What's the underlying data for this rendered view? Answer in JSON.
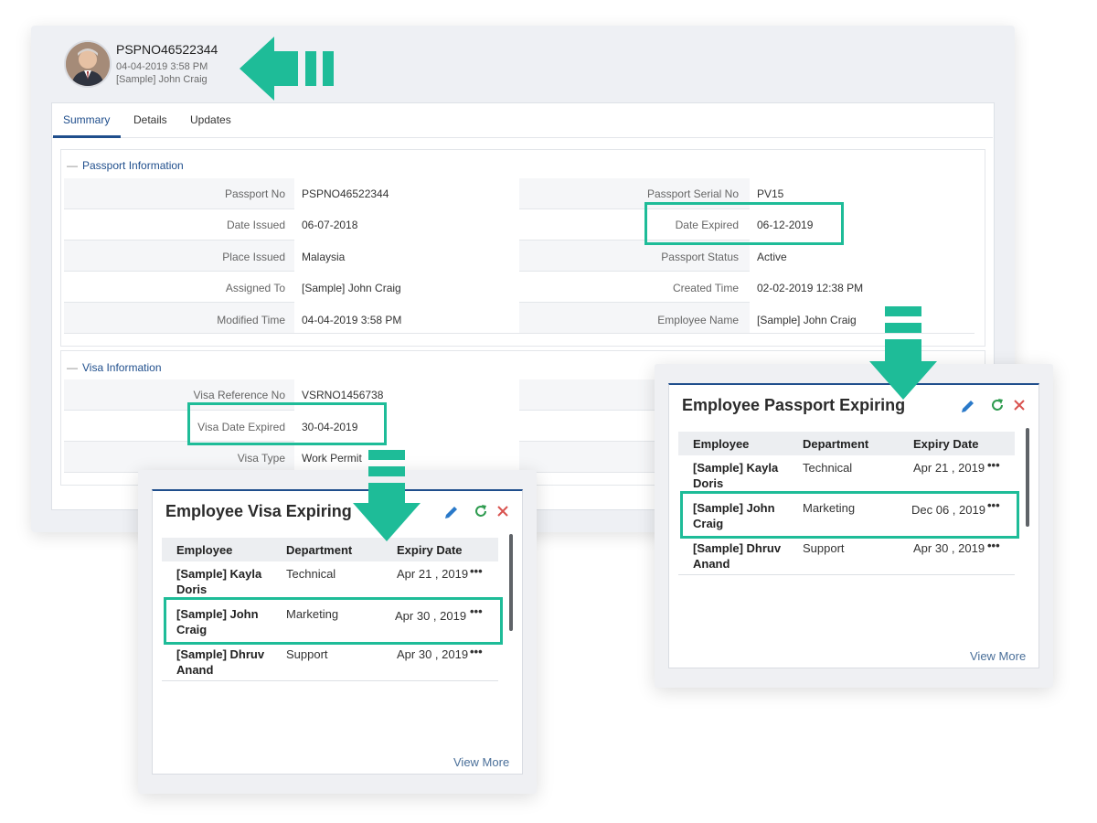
{
  "record": {
    "title": "PSPNO46522344",
    "timestamp": "04-04-2019 3:58 PM",
    "owner": "[Sample] John Craig",
    "tabs": [
      "Summary",
      "Details",
      "Updates"
    ]
  },
  "passport_section": {
    "heading": "Passport Information",
    "collapse_icon": "minus-icon",
    "left": [
      {
        "label": "Passport No",
        "value": "PSPNO46522344"
      },
      {
        "label": "Date Issued",
        "value": "06-07-2018"
      },
      {
        "label": "Place Issued",
        "value": "Malaysia"
      },
      {
        "label": "Assigned To",
        "value": "[Sample] John Craig"
      },
      {
        "label": "Modified Time",
        "value": "04-04-2019 3:58 PM"
      }
    ],
    "right": [
      {
        "label": "Passport Serial No",
        "value": "PV15"
      },
      {
        "label": "Date Expired",
        "value": "06-12-2019"
      },
      {
        "label": "Passport Status",
        "value": "Active"
      },
      {
        "label": "Created Time",
        "value": "02-02-2019 12:38 PM"
      },
      {
        "label": "Employee Name",
        "value": "[Sample] John Craig"
      }
    ]
  },
  "visa_section": {
    "heading": "Visa Information",
    "collapse_icon": "minus-icon",
    "left": [
      {
        "label": "Visa Reference No",
        "value": "VSRNO1456738"
      },
      {
        "label": "Visa Date Expired",
        "value": "30-04-2019"
      },
      {
        "label": "Visa Type",
        "value": "Work Permit"
      }
    ]
  },
  "visa_widget": {
    "title": "Employee Visa Expiring",
    "columns": [
      "Employee",
      "Department",
      "Expiry Date"
    ],
    "rows": [
      {
        "name1": "[Sample] Kayla",
        "name2": "Doris",
        "department": "Technical",
        "expiry": "Apr 21 , 2019"
      },
      {
        "name1": "[Sample] John",
        "name2": "Craig",
        "department": "Marketing",
        "expiry": "Apr 30  , 2019"
      },
      {
        "name1": "[Sample] Dhruv",
        "name2": "Anand",
        "department": "Support",
        "expiry": "Apr 30 , 2019"
      }
    ],
    "more_icon": "•••",
    "view_more": "View More",
    "icons": [
      "edit-icon",
      "refresh-icon",
      "close-icon"
    ]
  },
  "passport_widget": {
    "title": "Employee Passport Expiring",
    "columns": [
      "Employee",
      "Department",
      "Expiry Date"
    ],
    "rows": [
      {
        "name1": "[Sample] Kayla",
        "name2": "Doris",
        "department": "Technical",
        "expiry": "Apr 21 , 2019"
      },
      {
        "name1": "[Sample] John",
        "name2": "Craig",
        "department": "Marketing",
        "expiry": "Dec 06  , 2019"
      },
      {
        "name1": "[Sample] Dhruv",
        "name2": "Anand",
        "department": "Support",
        "expiry": "Apr 30 , 2019"
      }
    ],
    "more_icon": "•••",
    "view_more": "View More",
    "icons": [
      "edit-icon",
      "refresh-icon",
      "close-icon"
    ]
  },
  "colors": {
    "accent": "#1ebc98",
    "brand": "#1f4e8c",
    "edit": "#2a79c9",
    "refresh": "#2e9b4f",
    "close": "#d9534f"
  }
}
